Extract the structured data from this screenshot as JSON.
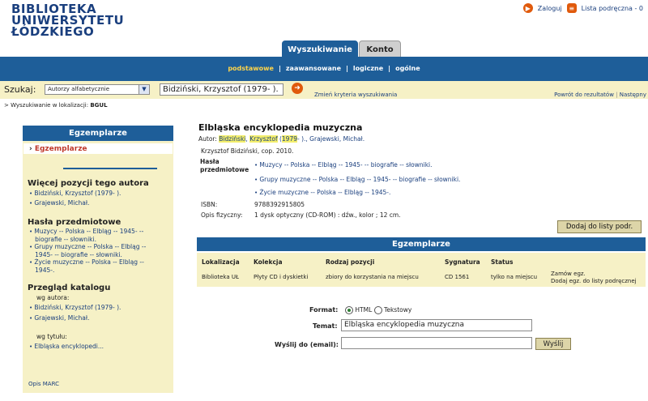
{
  "logo": {
    "line1": "BIBLIOTEKA",
    "line2": "UNIWERSYTETU",
    "line3": "ŁÓDZKIEGO"
  },
  "topbar": {
    "login": "Zaloguj",
    "list": "Lista podręczna - 0"
  },
  "tabs": [
    {
      "label": "Wyszukiwanie"
    },
    {
      "label": "Konto"
    }
  ],
  "subnav": [
    "podstawowe",
    "zaawansowane",
    "logiczne",
    "ogólne"
  ],
  "search": {
    "label": "Szukaj:",
    "index_value": "Autorzy alfabetycznie",
    "query_value": "Bidziński, Krzysztof (1979- ).",
    "change_criteria": "Zmień kryteria wyszukiwania",
    "back": "Powrót do rezultatów",
    "next": "Następny",
    "location_prefix": "> Wyszukiwanie w lokalizacji:",
    "location_value": "BGUL"
  },
  "sidebar": {
    "header": "Egzemplarze",
    "selected": "Egzemplarze",
    "more_author_title": "Więcej pozycji tego autora",
    "more_author": [
      "Bidziński, Krzysztof (1979- ).",
      "Grajewski, Michał."
    ],
    "subjects_title": "Hasła przedmiotowe",
    "subjects": [
      [
        "Muzycy -- Polska -- Elbląg -- 1945- --",
        "biografie -- słowniki."
      ],
      [
        "Grupy muzyczne -- Polska -- Elbląg --",
        "1945- -- biografie -- słowniki."
      ],
      [
        "Życie muzyczne -- Polska -- Elbląg --",
        "1945-."
      ]
    ],
    "catalog_title": "Przegląd katalogu",
    "by_author": "wg autora:",
    "by_author_items": [
      "Bidziński, Krzysztof (1979- ).",
      "Grajewski, Michał."
    ],
    "by_title": "wg tytułu:",
    "by_title_items": [
      "Elbląska encyklopedi..."
    ],
    "marc": "Opis MARC"
  },
  "record": {
    "title": "Elbląska encyklopedia muzyczna",
    "author_label": "Autor:",
    "author_name_hl1": "Bidziński",
    "author_name_hl2": "Krzysztof",
    "author_year_hl": "1979",
    "author_rest": "- ).,  Grajewski, Michał.",
    "publication": "Krzysztof Bidziński, cop. 2010.",
    "subjects_label_1": "Hasła",
    "subjects_label_2": "przedmiotowe",
    "subjects": [
      "Muzycy -- Polska -- Elbląg -- 1945- -- biografie -- słowniki.",
      "Grupy muzyczne -- Polska -- Elbląg -- 1945- -- biografie -- słowniki.",
      "Życie muzyczne -- Polska -- Elbląg -- 1945-."
    ],
    "isbn_label": "ISBN:",
    "isbn": "9788392915805",
    "physical_label": "Opis fizyczny:",
    "physical": "1 dysk optyczny (CD-ROM) : dźw., kolor ; 12 cm."
  },
  "add_to_list": "Dodaj do listy podr.",
  "copies": {
    "header": "Egzemplarze",
    "columns": [
      "Lokalizacja",
      "Kolekcja",
      "Rodzaj pozycji",
      "Sygnatura",
      "Status"
    ],
    "row": {
      "location": "Biblioteka UŁ",
      "collection": "Płyty CD i dyskietki",
      "type": "zbiory do korzystania na miejscu",
      "signature": "CD 1561",
      "status": "tylko na miejscu",
      "order": "Zamów egz.",
      "add": "Dodaj egz. do listy podręcznej"
    }
  },
  "email_form": {
    "format_label": "Format:",
    "opt_html": "HTML",
    "opt_text": "Tekstowy",
    "subject_label": "Temat:",
    "subject_value": "Elbląska encyklopedia muzyczna",
    "send_to_label": "Wyślij do (email):",
    "send_to_value": "",
    "send_button": "Wyślij"
  },
  "colors": {
    "navy": "#1e5e99",
    "cream": "#f6f1c6",
    "accent": "#e05a0c",
    "highlight": "#f3ee6c"
  }
}
